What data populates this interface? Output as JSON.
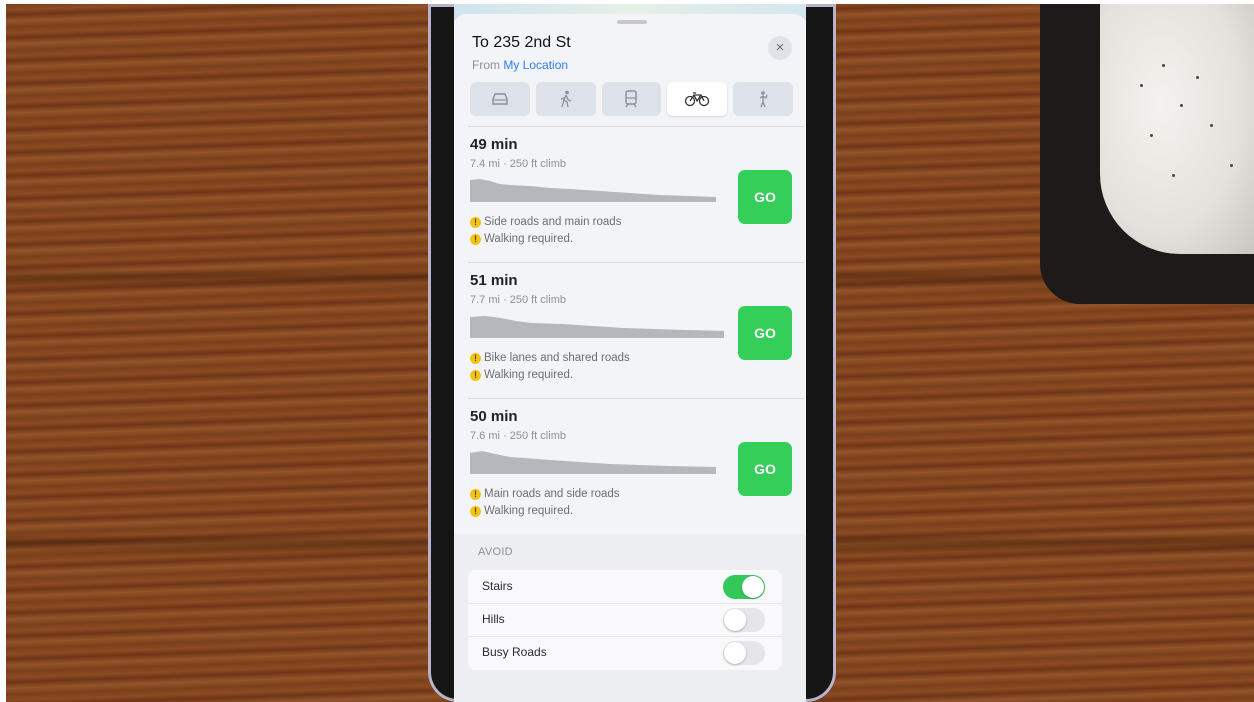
{
  "header": {
    "title": "To 235 2nd St",
    "from_prefix": "From",
    "from_location": "My Location",
    "close_icon": "×"
  },
  "transport_modes": [
    {
      "name": "drive",
      "icon": "car-icon",
      "active": false
    },
    {
      "name": "walk",
      "icon": "walking-icon",
      "active": false
    },
    {
      "name": "transit",
      "icon": "transit-icon",
      "active": false
    },
    {
      "name": "cycle",
      "icon": "bicycle-icon",
      "active": true
    },
    {
      "name": "ride-share",
      "icon": "ride-share-icon",
      "active": false
    }
  ],
  "routes": [
    {
      "time": "49 min",
      "meta": "7.4 mi · 250 ft climb",
      "notes": [
        "Side roads and main roads",
        "Walking required."
      ],
      "go_label": "GO"
    },
    {
      "time": "51 min",
      "meta": "7.7 mi · 250 ft climb",
      "notes": [
        "Bike lanes and shared roads",
        "Walking required."
      ],
      "go_label": "GO"
    },
    {
      "time": "50 min",
      "meta": "7.6 mi · 250 ft climb",
      "notes": [
        "Main roads and side roads",
        "Walking required."
      ],
      "go_label": "GO"
    }
  ],
  "avoid": {
    "header": "AVOID",
    "options": [
      {
        "label": "Stairs",
        "on": true
      },
      {
        "label": "Hills",
        "on": false
      },
      {
        "label": "Busy Roads",
        "on": false
      }
    ]
  },
  "colors": {
    "go_green": "#33cf58",
    "toggle_on": "#34c759",
    "link_blue": "#2f7cf6",
    "warning_yellow": "#f2c418"
  }
}
